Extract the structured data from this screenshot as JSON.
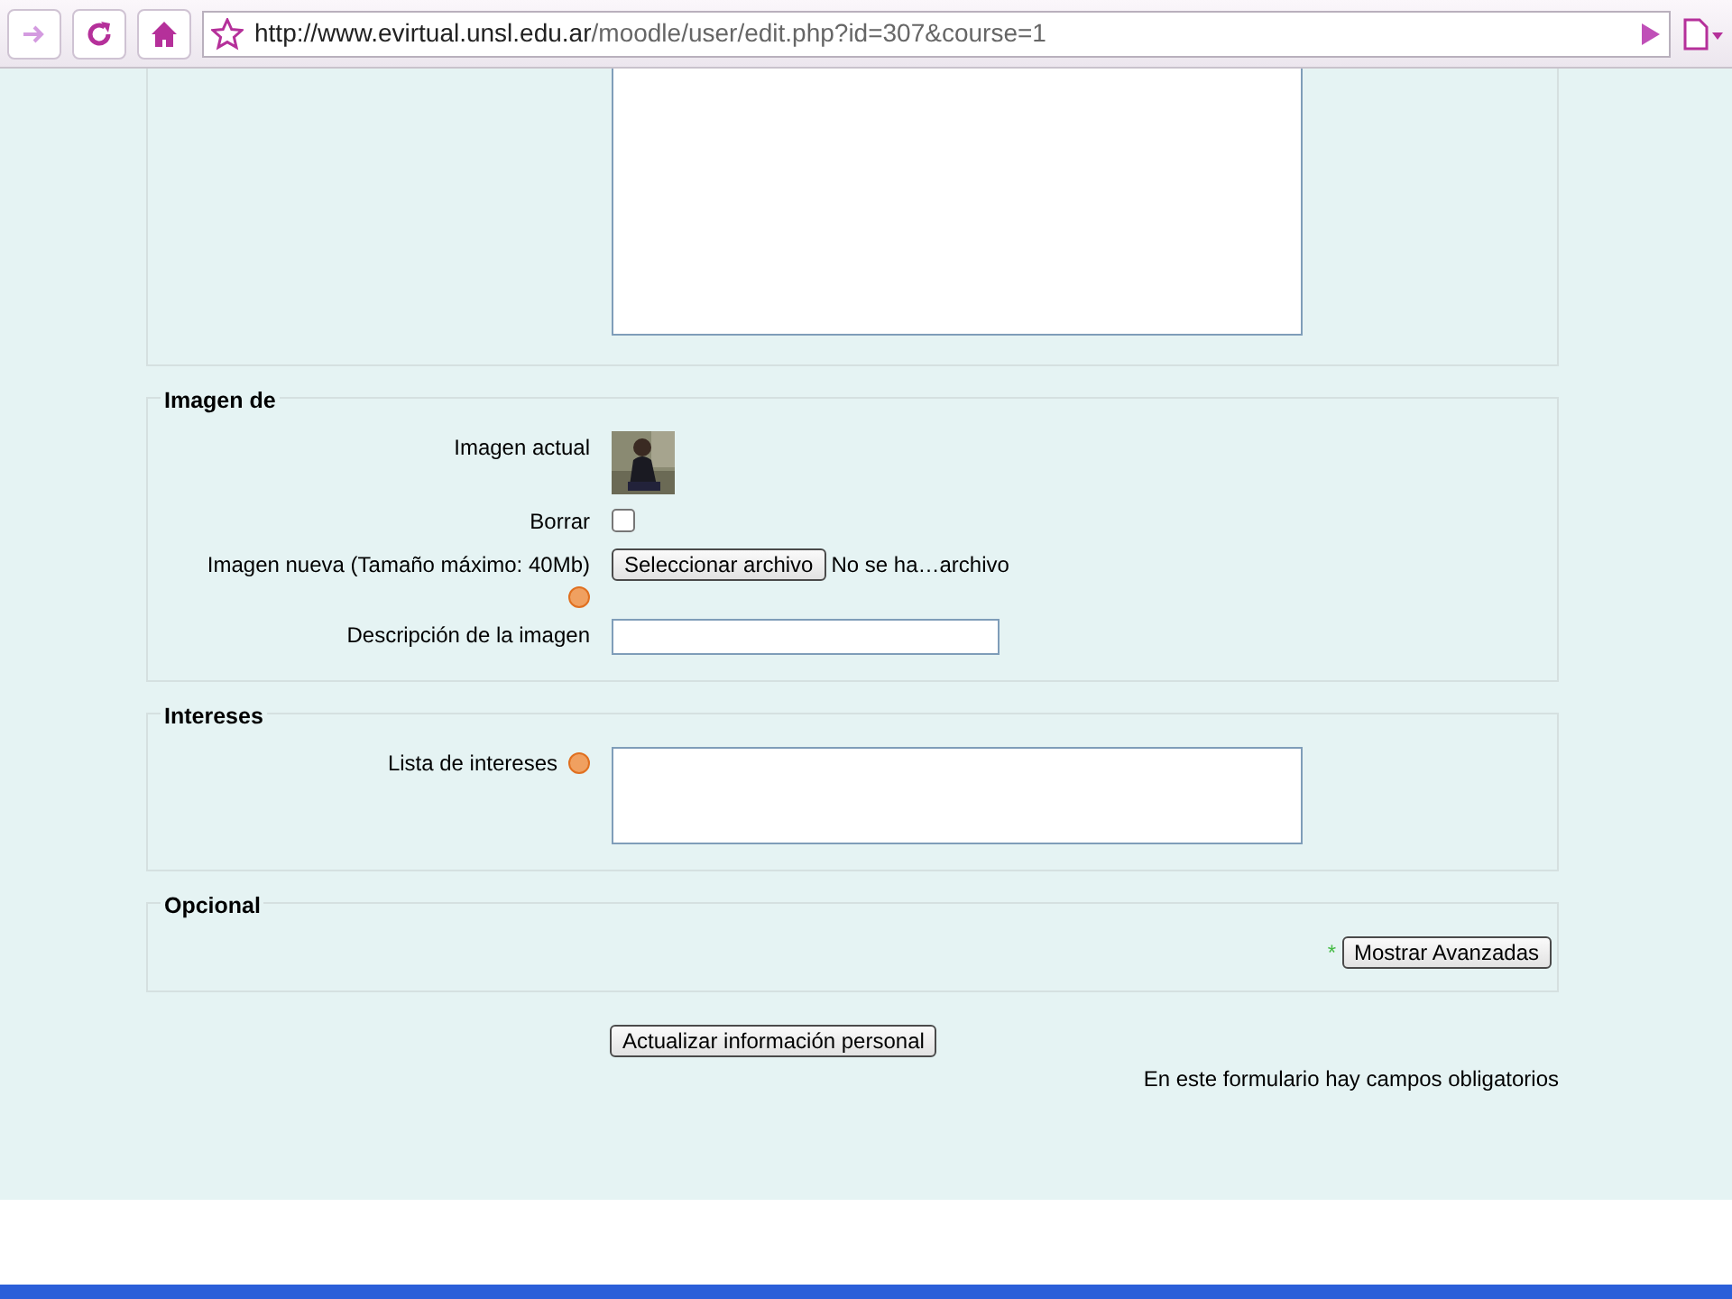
{
  "browser": {
    "url_host": "http://www.evirtual.unsl.edu.ar",
    "url_path": "/moodle/user/edit.php?id=307&course=1"
  },
  "sections": [
    {
      "kind": "cut",
      "rows": [
        {
          "kind": "textarea",
          "tall": true
        }
      ]
    },
    {
      "kind": "fieldset",
      "legend": "Imagen de",
      "rows": [
        {
          "label": "Imagen actual"
        },
        {
          "kind": "checkbox",
          "label": "Borrar",
          "checked": false
        },
        {
          "kind": "file",
          "label": "Imagen nueva (Tamaño máximo: 40Mb)",
          "help": true,
          "button": "Seleccionar archivo",
          "status": "No se ha…archivo"
        },
        {
          "kind": "text",
          "label": "Descripción de la imagen"
        }
      ]
    },
    {
      "kind": "fieldset",
      "legend": "Intereses",
      "rows": [
        {
          "kind": "textarea",
          "label": "Lista de intereses",
          "help": true,
          "tall": false
        }
      ]
    },
    {
      "kind": "fieldset",
      "legend": "Opcional",
      "rows": [
        {
          "kind": "advanced",
          "mark": "*",
          "button": "Mostrar Avanzadas"
        }
      ]
    }
  ],
  "submit": "Actualizar información personal",
  "required_note": "En este formulario hay campos obligatorios"
}
